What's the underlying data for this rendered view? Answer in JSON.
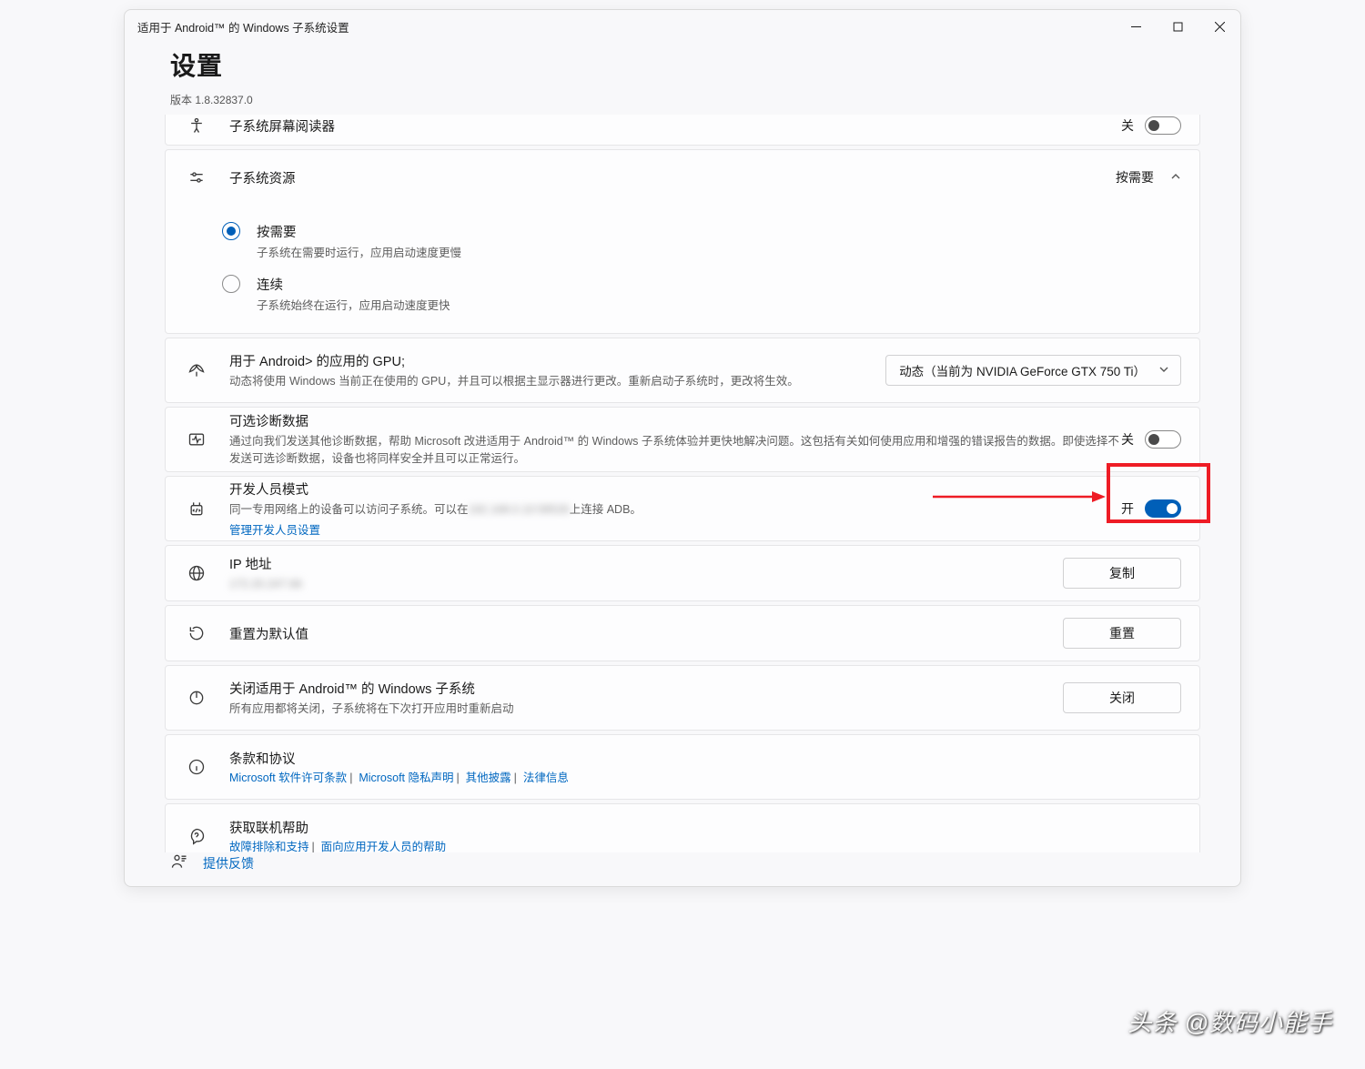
{
  "window": {
    "title": "适用于 Android™ 的 Windows 子系统设置"
  },
  "header": {
    "title": "设置",
    "version": "版本 1.8.32837.0"
  },
  "rows": {
    "screenreader": {
      "title": "子系统屏幕阅读器",
      "state": "关"
    },
    "resources": {
      "title": "子系统资源",
      "state": "按需要",
      "opt1_t": "按需要",
      "opt1_d": "子系统在需要时运行，应用启动速度更慢",
      "opt2_t": "连续",
      "opt2_d": "子系统始终在运行，应用启动速度更快"
    },
    "gpu": {
      "title": "用于 Android> 的应用的 GPU;",
      "desc": "动态将使用 Windows 当前正在使用的 GPU，并且可以根据主显示器进行更改。重新启动子系统时，更改将生效。",
      "select": "动态（当前为 NVIDIA GeForce GTX 750 Ti）"
    },
    "diag": {
      "title": "可选诊断数据",
      "desc": "通过向我们发送其他诊断数据，帮助 Microsoft 改进适用于 Android™ 的 Windows 子系统体验并更快地解决问题。这包括有关如何使用应用和增强的错误报告的数据。即使选择不发送可选诊断数据，设备也将同样安全并且可以正常运行。",
      "state": "关"
    },
    "dev": {
      "title": "开发人员模式",
      "desc_a": "同一专用网络上的设备可以访问子系统。可以在",
      "desc_b": "上连接 ADB。",
      "blur_ip": "192.168.0.10:58526",
      "link": "管理开发人员设置",
      "state": "开"
    },
    "ip": {
      "title": "IP 地址",
      "value": "172.20.247.66",
      "btn": "复制"
    },
    "reset": {
      "title": "重置为默认值",
      "btn": "重置"
    },
    "shutdown": {
      "title": "关闭适用于 Android™ 的 Windows 子系统",
      "desc": "所有应用都将关闭，子系统将在下次打开应用时重新启动",
      "btn": "关闭"
    },
    "terms": {
      "title": "条款和协议",
      "l1": "Microsoft 软件许可条款",
      "l2": "Microsoft 隐私声明",
      "l3": "其他披露",
      "l4": "法律信息"
    },
    "help": {
      "title": "获取联机帮助",
      "l1": "故障排除和支持",
      "l2": "面向应用开发人员的帮助"
    }
  },
  "footer": {
    "feedback": "提供反馈"
  },
  "watermark": "头条 @数码小能手"
}
